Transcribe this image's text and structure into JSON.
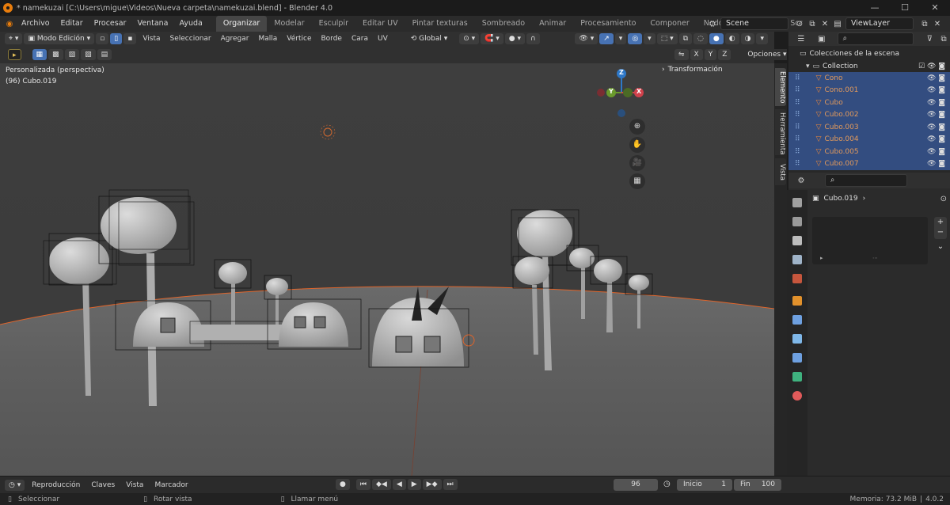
{
  "window": {
    "title": "* namekuzai [C:\\Users\\migue\\Videos\\Nueva carpeta\\namekuzai.blend] - Blender 4.0",
    "minimize": "—",
    "maximize": "☐",
    "close": "✕"
  },
  "menu": [
    "Archivo",
    "Editar",
    "Procesar",
    "Ventana",
    "Ayuda"
  ],
  "workspaces": [
    "Organizar",
    "Modelar",
    "Esculpir",
    "Editar UV",
    "Pintar texturas",
    "Sombreado",
    "Animar",
    "Procesamiento",
    "Componer",
    "Nodos de geometría",
    "Scr"
  ],
  "active_workspace": "Organizar",
  "scene": {
    "label": "Scene"
  },
  "viewlayer": {
    "label": "ViewLayer"
  },
  "viewport_header": {
    "mode": "Modo Edición",
    "menus": [
      "Vista",
      "Seleccionar",
      "Agregar",
      "Malla",
      "Vértice",
      "Borde",
      "Cara",
      "UV"
    ],
    "orientation": "Global",
    "axes": [
      "X",
      "Y",
      "Z"
    ],
    "options": "Opciones"
  },
  "viewport": {
    "view_name": "Personalizada (perspectiva)",
    "object_info": "(96) Cubo.019",
    "transform_panel": "Transformación",
    "gizmo_axes": [
      "Z",
      "Y",
      "X"
    ]
  },
  "side_tabs": [
    "Elemento",
    "Herramienta",
    "Vista"
  ],
  "outliner": {
    "header": "Colecciones de la escena",
    "collection": "Collection",
    "items": [
      "Cono",
      "Cono.001",
      "Cubo",
      "Cubo.002",
      "Cubo.003",
      "Cubo.004",
      "Cubo.005",
      "Cubo.007"
    ]
  },
  "properties": {
    "object_name": "Cubo.019",
    "tab_colors": [
      "#a0a0a0",
      "#9a9a9a",
      "#bdbdbd",
      "#9fb3c8",
      "#c6563d",
      "#e2912c",
      "#6ea0e0",
      "#7fb7e8",
      "#6ea0e0",
      "#3fb27f",
      "#e05a5a"
    ]
  },
  "timeline": {
    "menus": [
      "Reproducción",
      "Claves",
      "Vista",
      "Marcador"
    ],
    "current_frame": "96",
    "start_label": "Inicio",
    "start_value": "1",
    "end_label": "Fin",
    "end_value": "100"
  },
  "status": {
    "select": "Seleccionar",
    "rotate": "Rotar vista",
    "menu": "Llamar menú",
    "memory": "Memoria: 73.2 MiB",
    "version": "4.0.2"
  },
  "colors": {
    "selection_blue": "#334d80",
    "orange_accent": "#e87d0d",
    "axis_x": "#d0414b",
    "axis_y": "#6a9a2d",
    "axis_z": "#2e78c8"
  }
}
